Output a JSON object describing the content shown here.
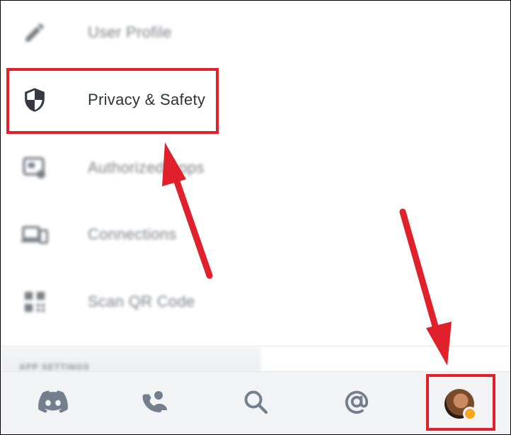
{
  "settings_menu": {
    "items": [
      {
        "label": "User Profile",
        "icon": "pencil-icon",
        "blurred": true
      },
      {
        "label": "Privacy & Safety",
        "icon": "shield-icon",
        "blurred": false
      },
      {
        "label": "Authorized Apps",
        "icon": "authorized-apps-icon",
        "blurred": true
      },
      {
        "label": "Connections",
        "icon": "devices-icon",
        "blurred": true
      },
      {
        "label": "Scan QR Code",
        "icon": "qr-code-icon",
        "blurred": true
      }
    ],
    "next_section_hint": "APP SETTINGS"
  },
  "tab_bar": {
    "tabs": [
      {
        "name": "home",
        "icon": "discord-icon"
      },
      {
        "name": "friends",
        "icon": "friends-icon"
      },
      {
        "name": "search",
        "icon": "search-icon"
      },
      {
        "name": "mentions",
        "icon": "at-icon"
      },
      {
        "name": "profile",
        "icon": "avatar",
        "status": "idle"
      }
    ]
  },
  "annotation": {
    "color": "#e0202a"
  },
  "colors": {
    "icon_gray": "#4f5660",
    "tab_icon_gray": "#747f8d",
    "status_idle": "#faa61a"
  }
}
